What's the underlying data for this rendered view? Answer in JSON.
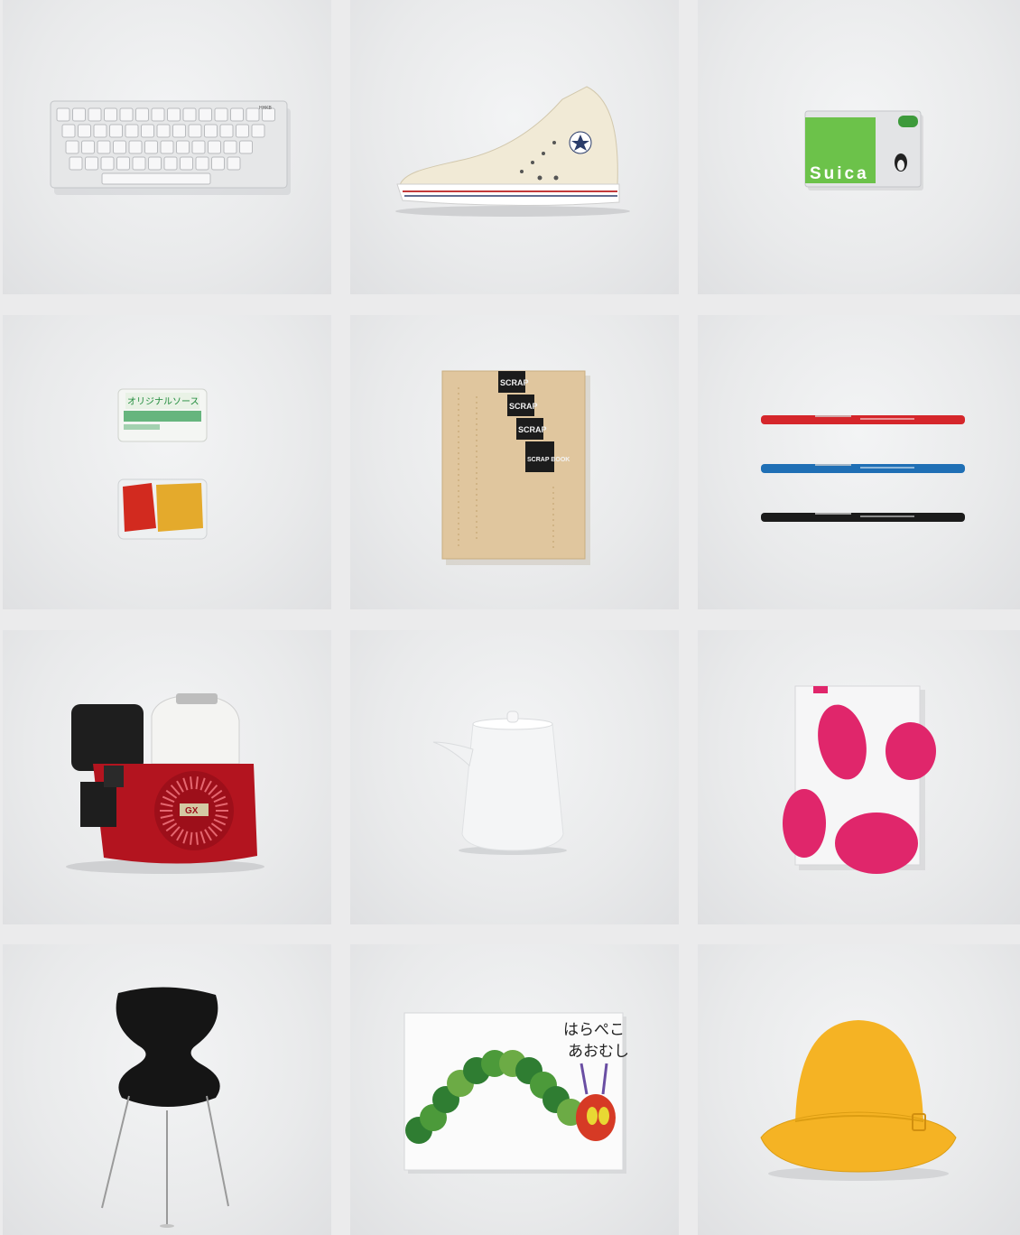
{
  "gallery": {
    "items": [
      {
        "id": "keyboard",
        "icon": "keyboard-icon",
        "label_text": "HHKB"
      },
      {
        "id": "sneaker",
        "icon": "high-top-sneaker-icon"
      },
      {
        "id": "ic-card",
        "icon": "transit-card-icon",
        "label_text": "Suica",
        "brand_color": "#6cc24a"
      },
      {
        "id": "sauce-packets",
        "icon": "sauce-packet-icon",
        "label_text": "オリジナルソース"
      },
      {
        "id": "scrapbook",
        "icon": "notebook-icon",
        "label_lines": [
          "SCRAP",
          "SCRAP",
          "SCRAP",
          "SCRAP BOOK"
        ]
      },
      {
        "id": "pens",
        "icon": "felt-pen-icon",
        "pen_colors": [
          "#d5262b",
          "#1f6fb5",
          "#1b1b1b"
        ]
      },
      {
        "id": "engine",
        "icon": "engine-icon",
        "label_text": "GX",
        "brand_color": "#b3141f"
      },
      {
        "id": "soy-sauce-pot",
        "icon": "soy-sauce-pot-icon"
      },
      {
        "id": "gift-box",
        "icon": "gift-box-icon",
        "brand_color": "#e0266b"
      },
      {
        "id": "ant-chair",
        "icon": "chair-icon"
      },
      {
        "id": "picture-book",
        "icon": "book-icon",
        "title_lines": [
          "はらぺこ",
          "あおむし"
        ]
      },
      {
        "id": "school-hat",
        "icon": "hat-icon",
        "brand_color": "#f5b324"
      }
    ]
  }
}
